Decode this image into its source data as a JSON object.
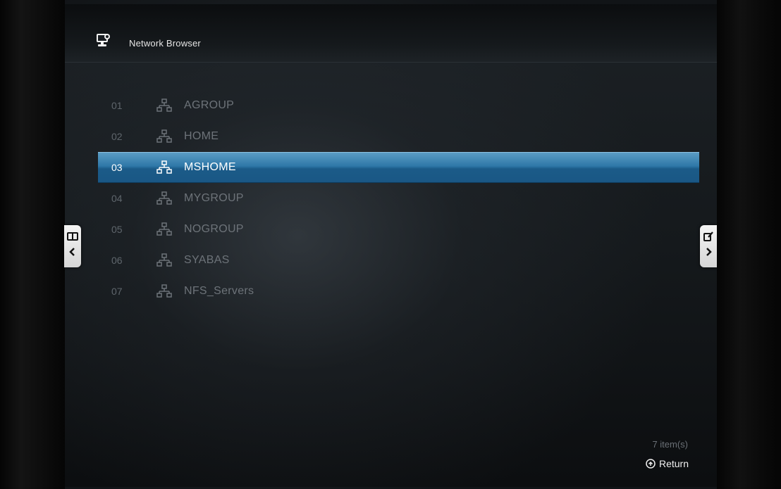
{
  "header": {
    "title": "Network Browser",
    "icon": "network-monitor-icon"
  },
  "list": {
    "selected_index": 2,
    "items": [
      {
        "num": "01",
        "label": "AGROUP",
        "icon": "network-workgroup-icon"
      },
      {
        "num": "02",
        "label": "HOME",
        "icon": "network-workgroup-icon"
      },
      {
        "num": "03",
        "label": "MSHOME",
        "icon": "network-workgroup-icon"
      },
      {
        "num": "04",
        "label": "MYGROUP",
        "icon": "network-workgroup-icon"
      },
      {
        "num": "05",
        "label": "NOGROUP",
        "icon": "network-workgroup-icon"
      },
      {
        "num": "06",
        "label": "SYABAS",
        "icon": "network-workgroup-icon"
      },
      {
        "num": "07",
        "label": "NFS_Servers",
        "icon": "network-workgroup-icon"
      }
    ]
  },
  "side_tabs": {
    "left": {
      "icon": "book-icon",
      "arrow": "chevron-left-icon"
    },
    "right": {
      "icon": "edit-icon",
      "arrow": "chevron-right-icon"
    }
  },
  "footer": {
    "item_count": "7 item(s)",
    "return_label": "Return",
    "return_icon": "return-button-icon"
  },
  "colors": {
    "selection": "#2f78a8",
    "text_dim": "#6d7379",
    "text_bright": "#ffffff"
  }
}
